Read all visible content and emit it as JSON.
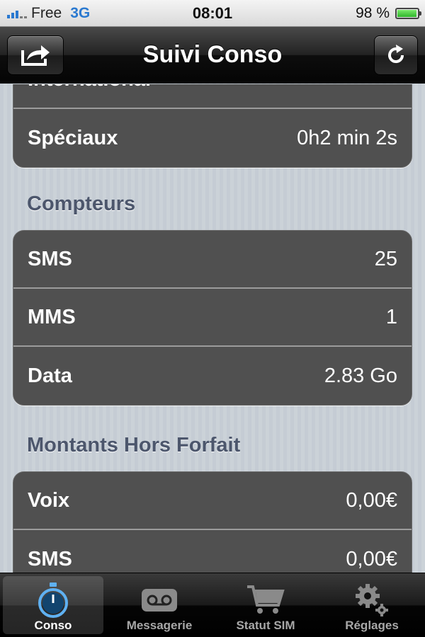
{
  "status_bar": {
    "carrier": "Free",
    "network": "3G",
    "time": "08:01",
    "battery": "98 %",
    "battery_level": 0.98
  },
  "nav": {
    "title": "Suivi Conso",
    "share_icon": "share-icon",
    "refresh_icon": "refresh-icon"
  },
  "appels": {
    "partial_label": "International",
    "rows": [
      {
        "label": "Spéciaux",
        "value": "0h2 min 2s"
      }
    ]
  },
  "compteurs": {
    "header": "Compteurs",
    "rows": [
      {
        "label": "SMS",
        "value": "25"
      },
      {
        "label": "MMS",
        "value": "1"
      },
      {
        "label": "Data",
        "value": "2.83 Go"
      }
    ]
  },
  "hors_forfait": {
    "header": "Montants Hors Forfait",
    "rows": [
      {
        "label": "Voix",
        "value": "0,00€"
      },
      {
        "label": "SMS",
        "value": "0,00€"
      }
    ]
  },
  "tabs": [
    {
      "label": "Conso",
      "icon": "stopwatch-icon",
      "active": true
    },
    {
      "label": "Messagerie",
      "icon": "voicemail-icon",
      "active": false
    },
    {
      "label": "Statut SIM",
      "icon": "cart-icon",
      "active": false
    },
    {
      "label": "Réglages",
      "icon": "gears-icon",
      "active": false
    }
  ],
  "colors": {
    "accent_blue": "#2a79d0",
    "section_header": "#4c566c",
    "cell_bg": "#505050"
  }
}
